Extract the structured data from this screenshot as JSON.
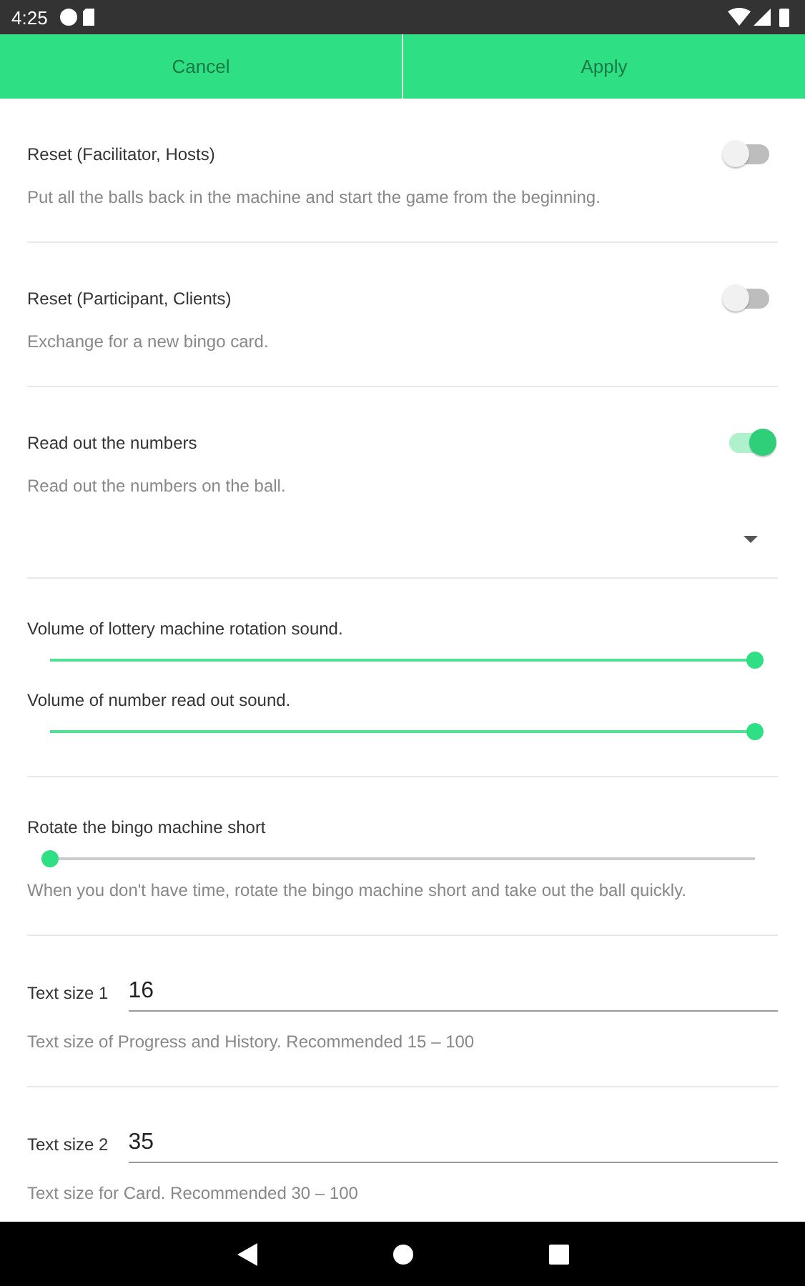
{
  "status_bar": {
    "time": "4:25"
  },
  "actions": [
    {
      "label": "Cancel"
    },
    {
      "label": "Apply"
    }
  ],
  "sections": [
    {
      "items": [
        {
          "kind": "toggle",
          "title": "Reset (Facilitator, Hosts)",
          "on": false,
          "description": "Put all the balls back in the machine and start the game from the beginning."
        }
      ]
    },
    {
      "items": [
        {
          "kind": "toggle",
          "title": "Reset (Participant, Clients)",
          "on": false,
          "description": "Exchange for a new bingo card."
        }
      ]
    },
    {
      "items": [
        {
          "kind": "toggle",
          "title": "Read out the numbers",
          "on": true,
          "description": "Read out the numbers on the ball."
        },
        {
          "kind": "dropdown"
        }
      ]
    },
    {
      "items": [
        {
          "kind": "slider",
          "title": "Volume of lottery machine rotation sound.",
          "level": 1
        },
        {
          "kind": "slider",
          "title": "Volume of number read out sound.",
          "level": 1
        }
      ]
    },
    {
      "items": [
        {
          "kind": "slider",
          "title": "Rotate the bingo machine short",
          "level": 0,
          "description": "When you don't have time, rotate the bingo machine short and take out the ball quickly."
        }
      ]
    },
    {
      "items": [
        {
          "kind": "number",
          "title": "Text size 1",
          "value": "16",
          "description": "Text size of Progress and History. Recommended 15 – 100"
        }
      ]
    },
    {
      "items": [
        {
          "kind": "number",
          "title": "Text size 2",
          "value": "35",
          "description": "Text size for Card. Recommended 30 – 100"
        }
      ]
    }
  ]
}
